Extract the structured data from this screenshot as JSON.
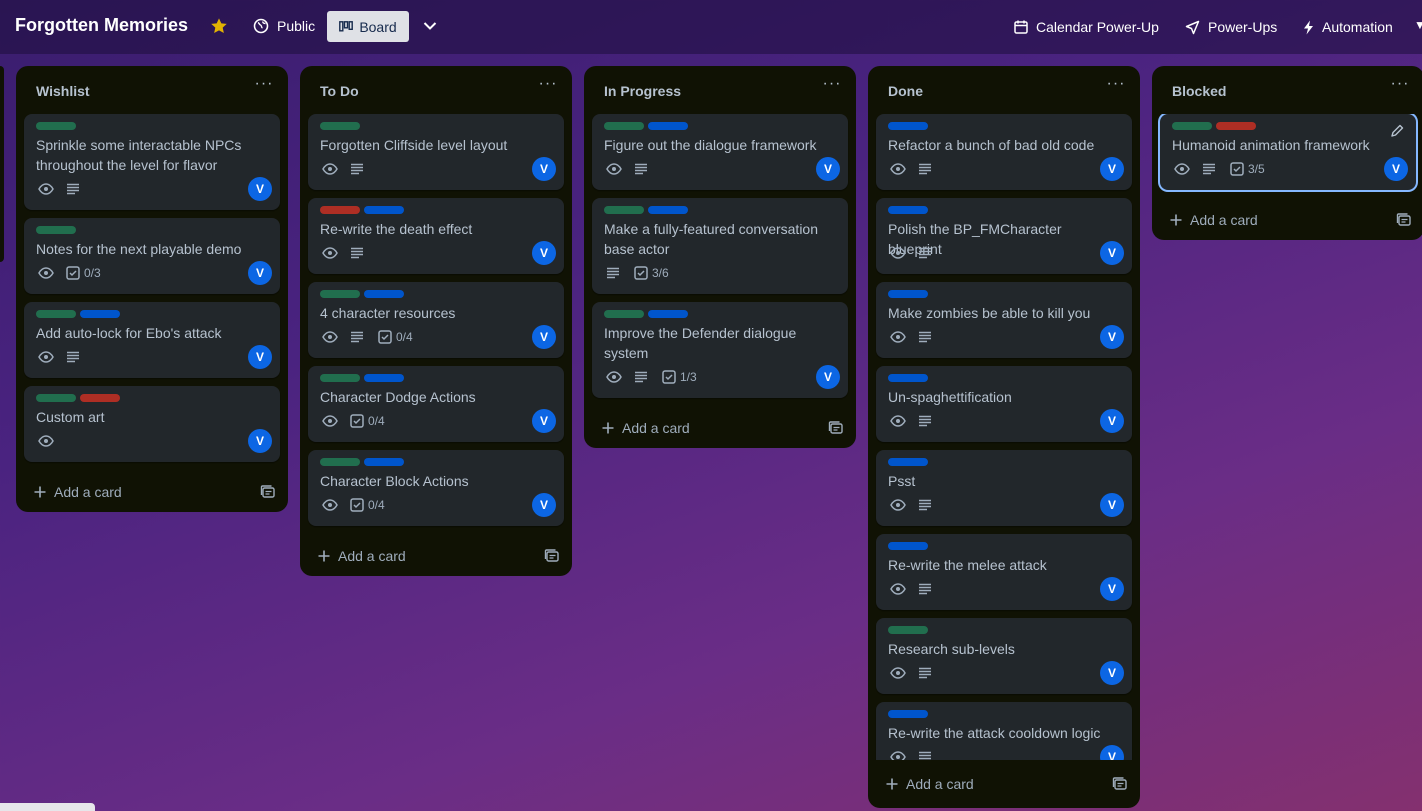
{
  "header": {
    "board_title": "Forgotten Memories",
    "visibility_label": "Public",
    "view_label": "Board",
    "calendar_label": "Calendar Power-Up",
    "powerups_label": "Power-Ups",
    "automation_label": "Automation"
  },
  "colors": {
    "label_green": "#216e4e",
    "label_blue": "#0055cc",
    "label_red": "#ae2e24",
    "avatar": "#0c66e4",
    "star": "#e2b203",
    "list_bg": "#101204",
    "card_bg": "#22272b"
  },
  "add_card_label": "Add a card",
  "lists": [
    {
      "title": "Wishlist",
      "cards": [
        {
          "labels": [
            "green"
          ],
          "title": "Sprinkle some interactable NPCs throughout the level for flavor",
          "badges": [
            "eye",
            "description"
          ],
          "avatar": "V"
        },
        {
          "labels": [
            "green"
          ],
          "title": "Notes for the next playable demo",
          "badges": [
            "eye",
            "checklist"
          ],
          "checklist": "0/3",
          "avatar": "V"
        },
        {
          "labels": [
            "green",
            "blue"
          ],
          "title": "Add auto-lock for Ebo's attack",
          "badges": [
            "eye",
            "description"
          ],
          "avatar": "V"
        },
        {
          "labels": [
            "green",
            "red"
          ],
          "title": "Custom art",
          "badges": [
            "eye"
          ],
          "avatar": "V"
        }
      ]
    },
    {
      "title": "To Do",
      "cards": [
        {
          "labels": [
            "green"
          ],
          "title": "Forgotten Cliffside level layout",
          "badges": [
            "eye",
            "description"
          ],
          "avatar": "V"
        },
        {
          "labels": [
            "red",
            "blue"
          ],
          "title": "Re-write the death effect",
          "badges": [
            "eye",
            "description"
          ],
          "avatar": "V"
        },
        {
          "labels": [
            "green",
            "blue"
          ],
          "title": "4 character resources",
          "badges": [
            "eye",
            "description",
            "checklist"
          ],
          "checklist": "0/4",
          "avatar": "V"
        },
        {
          "labels": [
            "green",
            "blue"
          ],
          "title": "Character Dodge Actions",
          "badges": [
            "eye",
            "checklist"
          ],
          "checklist": "0/4",
          "avatar": "V"
        },
        {
          "labels": [
            "green",
            "blue"
          ],
          "title": "Character Block Actions",
          "badges": [
            "eye",
            "checklist"
          ],
          "checklist": "0/4",
          "avatar": "V"
        }
      ]
    },
    {
      "title": "In Progress",
      "cards": [
        {
          "labels": [
            "green",
            "blue"
          ],
          "title": "Figure out the dialogue framework",
          "badges": [
            "eye",
            "description"
          ],
          "avatar": "V"
        },
        {
          "labels": [
            "green",
            "blue"
          ],
          "title": "Make a fully-featured conversation base actor",
          "badges": [
            "description",
            "checklist"
          ],
          "checklist": "3/6"
        },
        {
          "labels": [
            "green",
            "blue"
          ],
          "title": "Improve the Defender dialogue system",
          "badges": [
            "eye",
            "description",
            "checklist"
          ],
          "checklist": "1/3",
          "avatar": "V"
        }
      ]
    },
    {
      "title": "Done",
      "cards": [
        {
          "labels": [
            "blue"
          ],
          "title": "Refactor a bunch of bad old code",
          "badges": [
            "eye",
            "description"
          ],
          "avatar": "V"
        },
        {
          "labels": [
            "blue"
          ],
          "title": "Polish the BP_FMCharacter blueprint",
          "badges": [
            "eye",
            "description"
          ],
          "avatar": "V"
        },
        {
          "labels": [
            "blue"
          ],
          "title": "Make zombies be able to kill you",
          "badges": [
            "eye",
            "description"
          ],
          "avatar": "V"
        },
        {
          "labels": [
            "blue"
          ],
          "title": "Un-spaghettification",
          "badges": [
            "eye",
            "description"
          ],
          "avatar": "V"
        },
        {
          "labels": [
            "blue"
          ],
          "title": "Psst",
          "badges": [
            "eye",
            "description"
          ],
          "avatar": "V"
        },
        {
          "labels": [
            "blue"
          ],
          "title": "Re-write the melee attack",
          "badges": [
            "eye",
            "description"
          ],
          "avatar": "V"
        },
        {
          "labels": [
            "green"
          ],
          "title": "Research sub-levels",
          "badges": [
            "eye",
            "description"
          ],
          "avatar": "V"
        },
        {
          "labels": [
            "blue"
          ],
          "title": "Re-write the attack cooldown logic",
          "badges": [
            "eye",
            "description"
          ],
          "avatar": "V"
        }
      ]
    },
    {
      "title": "Blocked",
      "cards": [
        {
          "labels": [
            "green",
            "red"
          ],
          "title": "Humanoid animation framework",
          "badges": [
            "eye",
            "description",
            "checklist"
          ],
          "checklist": "3/5",
          "avatar": "V",
          "selected": true
        }
      ]
    }
  ]
}
